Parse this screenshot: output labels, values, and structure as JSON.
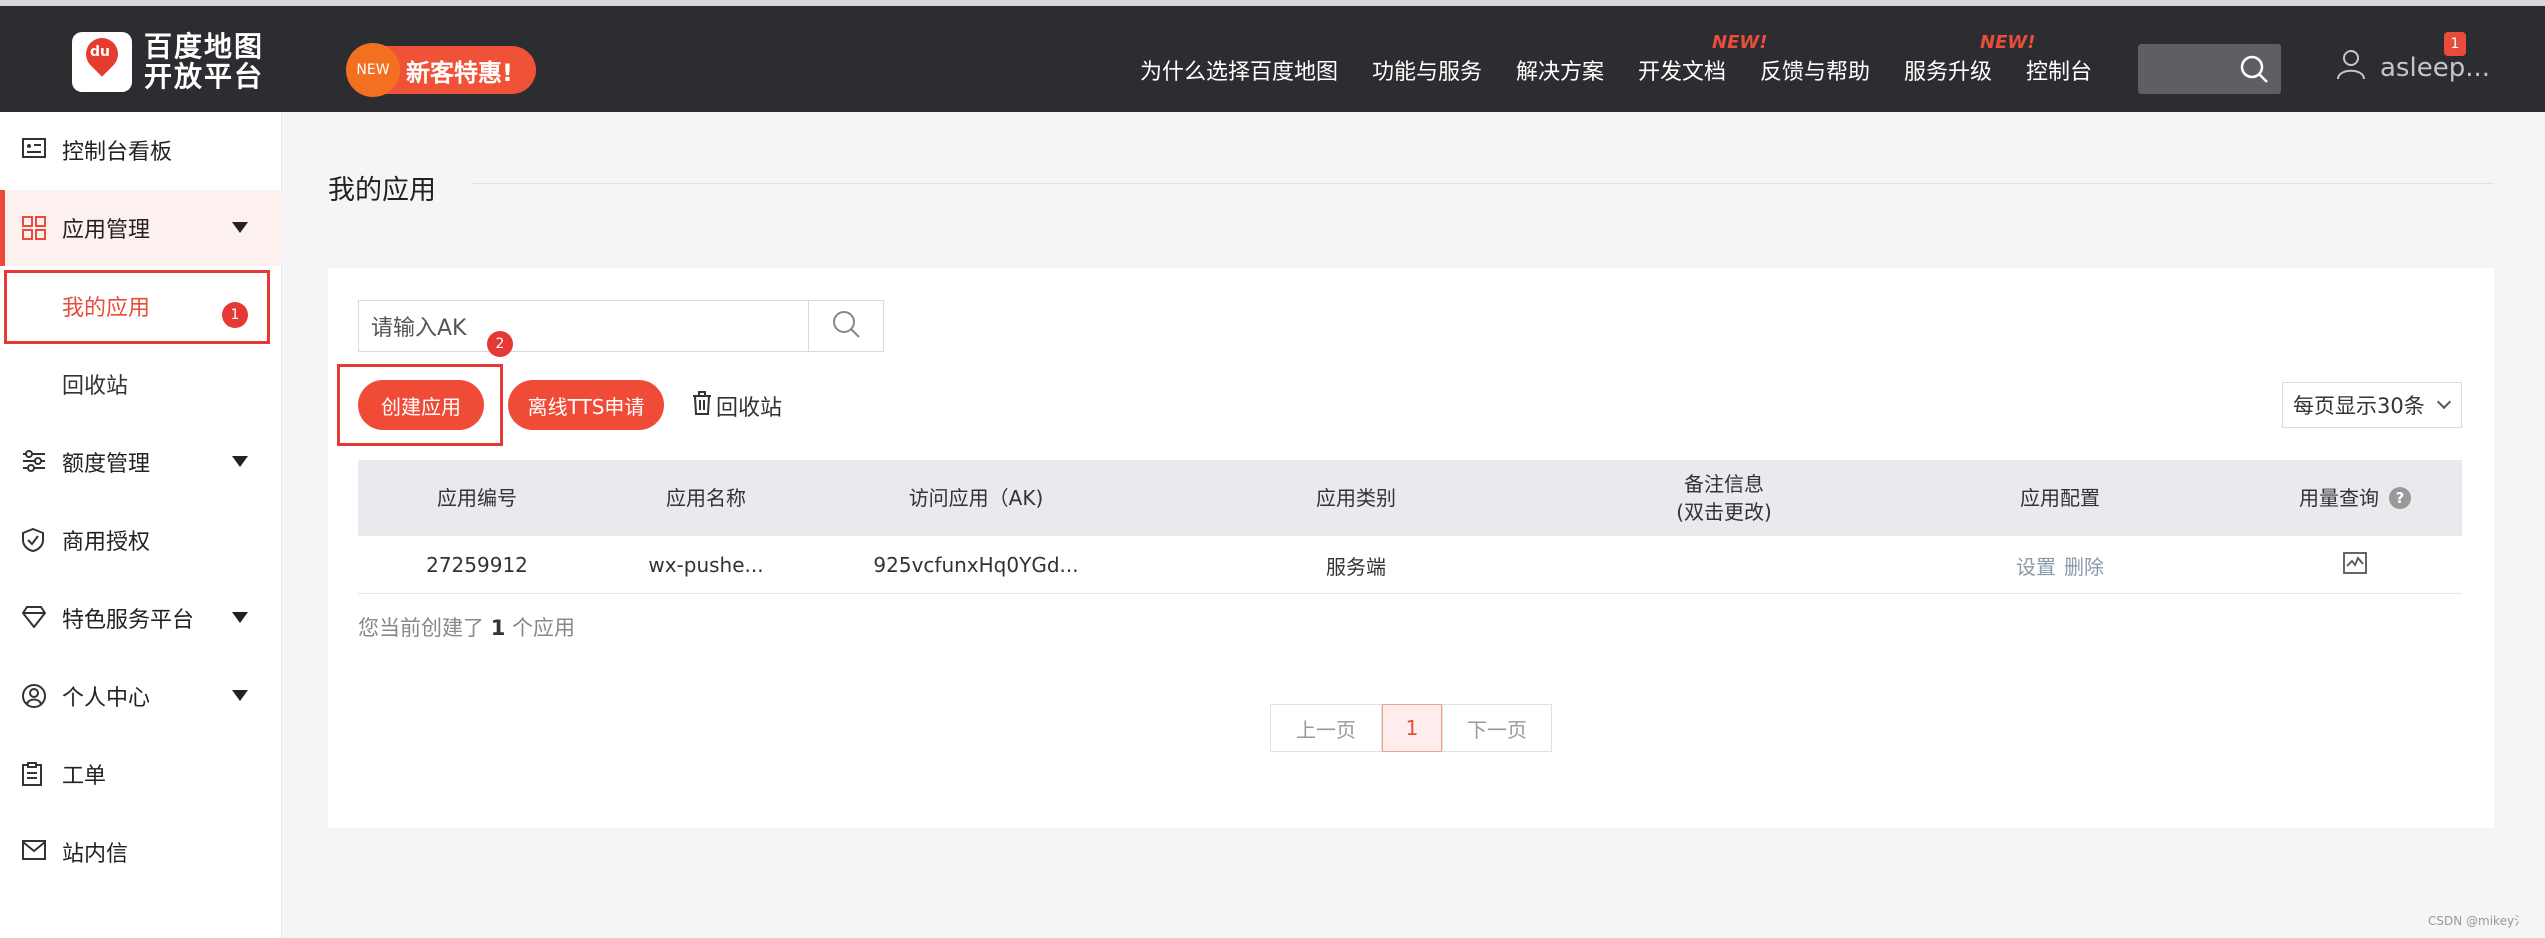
{
  "header": {
    "logo_line1": "百度地图",
    "logo_line2": "开放平台",
    "logo_mark_text": "du",
    "promo_badge": "NEW",
    "promo_text": "新客特惠!",
    "nav": [
      {
        "label": "为什么选择百度地图"
      },
      {
        "label": "功能与服务"
      },
      {
        "label": "解决方案"
      },
      {
        "label": "开发文档",
        "tag": "NEW!"
      },
      {
        "label": "反馈与帮助"
      },
      {
        "label": "服务升级",
        "tag": "NEW!"
      },
      {
        "label": "控制台"
      }
    ],
    "username": "asleep...",
    "notification_count": "1",
    "accent_color": "#e94c3a"
  },
  "sidebar": {
    "items": [
      {
        "label": "控制台看板",
        "icon": "dashboard-card-icon"
      },
      {
        "label": "应用管理",
        "icon": "grid-icon",
        "expanded": true
      },
      {
        "label": "我的应用",
        "sub": true,
        "active": true
      },
      {
        "label": "回收站",
        "sub": true
      },
      {
        "label": "额度管理",
        "icon": "sliders-icon"
      },
      {
        "label": "商用授权",
        "icon": "shield-check-icon"
      },
      {
        "label": "特色服务平台",
        "icon": "diamond-icon"
      },
      {
        "label": "个人中心",
        "icon": "user-circle-icon"
      },
      {
        "label": "工单",
        "icon": "clipboard-icon"
      },
      {
        "label": "站内信",
        "icon": "mail-icon"
      }
    ],
    "annotation_badge": "1"
  },
  "main": {
    "title": "我的应用",
    "search_placeholder": "请输入AK",
    "annotation_badge": "2",
    "create_button": "创建应用",
    "tts_button": "离线TTS申请",
    "recycle_label": "回收站",
    "per_page": "每页显示30条",
    "table": {
      "headers": [
        "应用编号",
        "应用名称",
        "访问应用（AK)",
        "应用类别",
        "备注信息",
        "(双击更改)",
        "应用配置",
        "用量查询"
      ],
      "rows": [
        {
          "id": "27259912",
          "name": "wx-pushe...",
          "ak": "925vcfunxHq0YGd...",
          "type": "服务端",
          "note": "",
          "settings": "设置",
          "delete": "删除"
        }
      ]
    },
    "summary_prefix": "您当前创建了",
    "summary_count": "1",
    "summary_suffix": "个应用",
    "pagination": {
      "prev": "上一页",
      "current": "1",
      "next": "下一页"
    }
  },
  "watermark": "CSDN @mikey氵"
}
